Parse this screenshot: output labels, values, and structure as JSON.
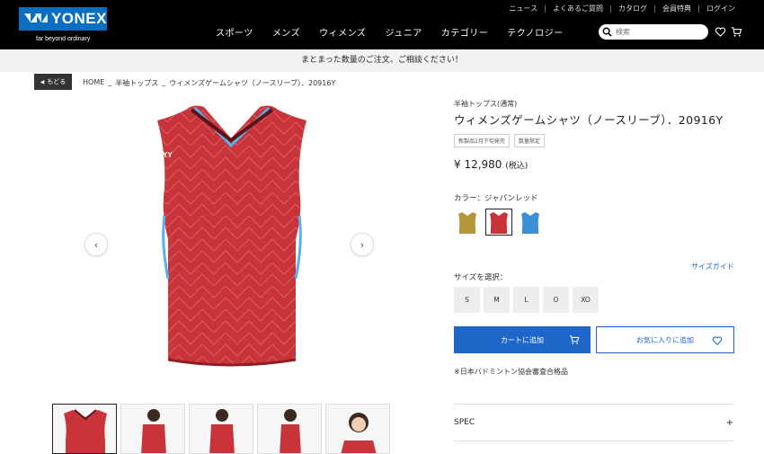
{
  "header": {
    "logo_text": "YONEX",
    "tagline": "far beyond ordinary",
    "utility_links": [
      "ニュース",
      "よくあるご質問",
      "カタログ",
      "会員特典",
      "ログイン"
    ],
    "nav_items": [
      "スポーツ",
      "メンズ",
      "ウィメンズ",
      "ジュニア",
      "カテゴリー",
      "テクノロジー"
    ],
    "search_placeholder": "検索"
  },
  "banner": {
    "text": "まとまった数量のご注文、ご相談ください！"
  },
  "breadcrumb": {
    "back_label": "もどる",
    "items": [
      "HOME",
      "半袖トップス",
      "ウィメンズゲームシャツ（ノースリーブ）．20916Y"
    ],
    "separator": "_"
  },
  "product": {
    "category": "半袖トップス(通常)",
    "title": "ウィメンズゲームシャツ（ノースリーブ）．20916Y",
    "badges": [
      "新製品2月下旬発売",
      "数量限定"
    ],
    "price": "¥ 12,980",
    "tax": "(税込)",
    "color_label": "カラー：ジャパンレッド",
    "colors": [
      {
        "name": "gold",
        "hex": "#b5973a"
      },
      {
        "name": "japan-red",
        "hex": "#c9343a"
      },
      {
        "name": "blue",
        "hex": "#3c8fd6"
      }
    ],
    "selected_color": 1,
    "size_guide": "サイズガイド",
    "size_label": "サイズを選択：",
    "sizes": [
      "S",
      "M",
      "L",
      "O",
      "XO"
    ],
    "cart_button": "カートに追加",
    "favorite_button": "お気に入りに追加",
    "note": "※日本バドミントン協会審査合格品",
    "spec_label": "SPEC",
    "spec_toggle": "+"
  },
  "colors": {
    "accent": "#1e66c8",
    "header_bg": "#000000",
    "shirt_red": "#c9343a"
  }
}
